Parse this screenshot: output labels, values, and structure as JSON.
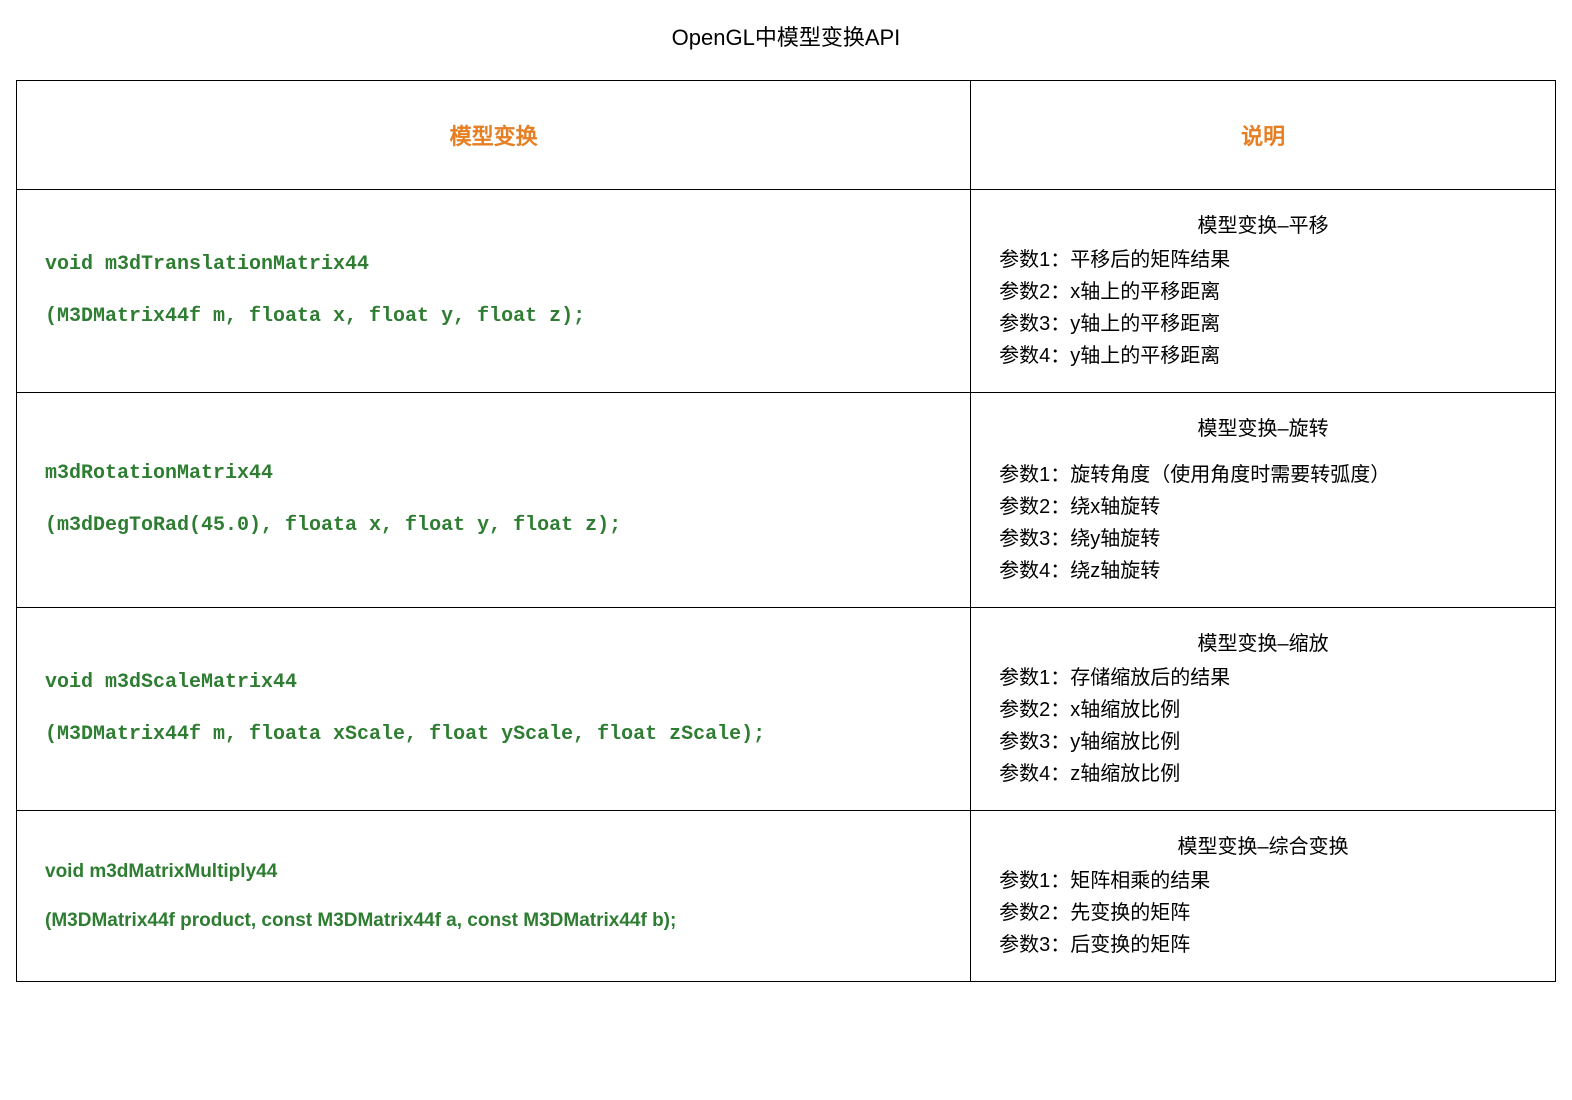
{
  "title": "OpenGL中模型变换API",
  "headers": {
    "api": "模型变换",
    "desc": "说明"
  },
  "rows": [
    {
      "api_line1": "void m3dTranslationMatrix44",
      "api_line2": "(M3DMatrix44f m, floata x, float y, float z);",
      "desc_heading": "模型变换–平移",
      "desc_lines": [
        "参数1：平移后的矩阵结果",
        "参数2：x轴上的平移距离",
        "参数3：y轴上的平移距离",
        "参数4：y轴上的平移距离"
      ],
      "has_gap": false
    },
    {
      "api_line1": "m3dRotationMatrix44",
      "api_line2": "(m3dDegToRad(45.0), floata x, float y, float z);",
      "desc_heading": "模型变换–旋转",
      "desc_lines": [
        "参数1：旋转角度（使用角度时需要转弧度）",
        "参数2：绕x轴旋转",
        "参数3：绕y轴旋转",
        "参数4：绕z轴旋转"
      ],
      "has_gap": true
    },
    {
      "api_line1": "void m3dScaleMatrix44",
      "api_line2": "(M3DMatrix44f m, floata xScale, float yScale, float zScale);",
      "desc_heading": "模型变换–缩放",
      "desc_lines": [
        "参数1：存储缩放后的结果",
        "参数2：x轴缩放比例",
        "参数3：y轴缩放比例",
        "参数4：z轴缩放比例"
      ],
      "has_gap": false
    },
    {
      "api_line1": "void m3dMatrixMultiply44",
      "api_line2": "(M3DMatrix44f product, const M3DMatrix44f a, const M3DMatrix44f b);",
      "desc_heading": "模型变换–综合变换",
      "desc_lines": [
        "参数1：矩阵相乘的结果",
        "参数2：先变换的矩阵",
        "参数3：后变换的矩阵"
      ],
      "has_gap": false,
      "sans": true
    }
  ]
}
